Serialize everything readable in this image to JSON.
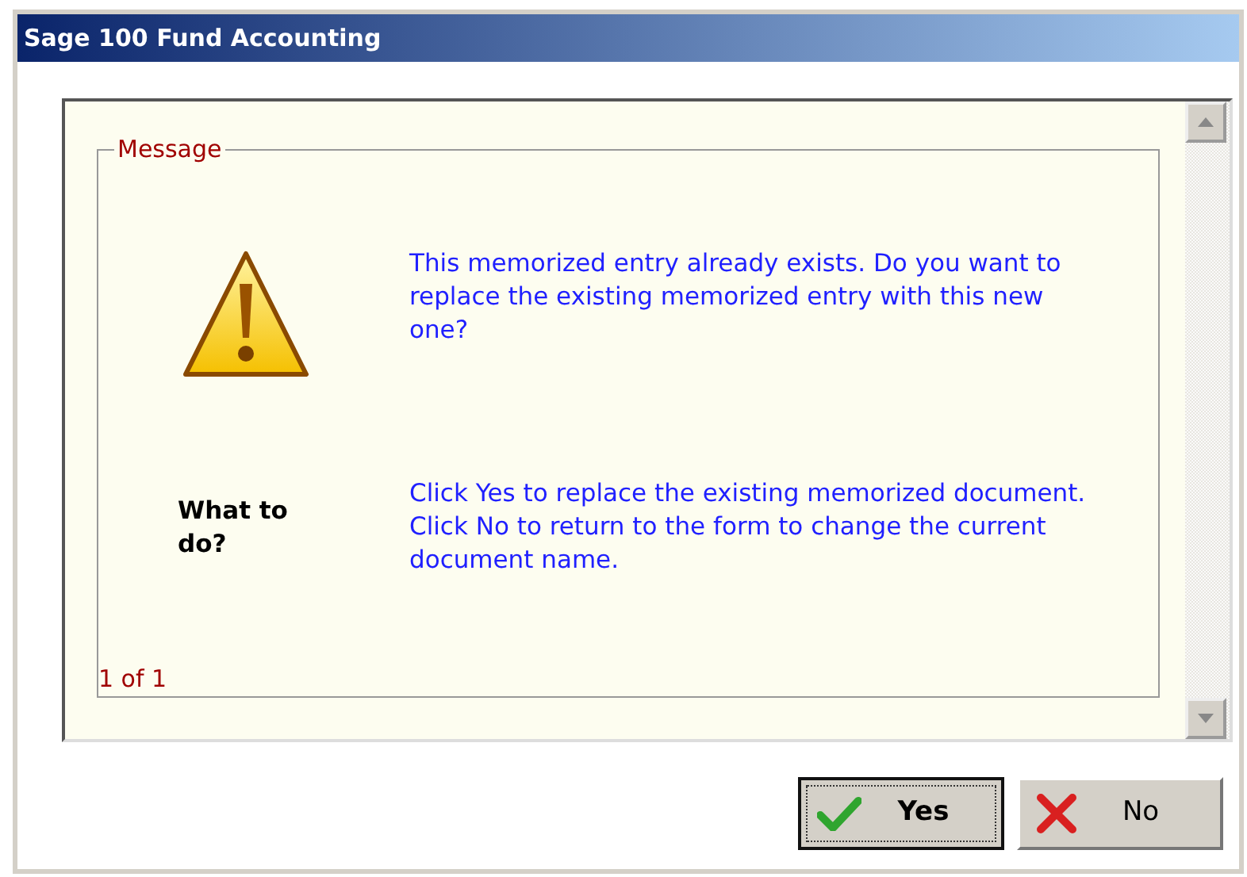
{
  "window": {
    "title": "Sage 100 Fund Accounting"
  },
  "message_group": {
    "legend": "Message",
    "sections": [
      {
        "kind": "warning",
        "text": "This memorized entry already exists. Do you want to replace the existing memorized entry with this new one?"
      },
      {
        "kind": "heading",
        "heading": "What to do?",
        "text": "Click Yes to replace the existing memorized document. Click No to return to the form to change the current document name."
      }
    ],
    "pager": "1 of 1"
  },
  "buttons": [
    {
      "kind": "yes",
      "label": "Yes",
      "focused": true
    },
    {
      "kind": "no",
      "label": "No",
      "focused": false
    }
  ]
}
